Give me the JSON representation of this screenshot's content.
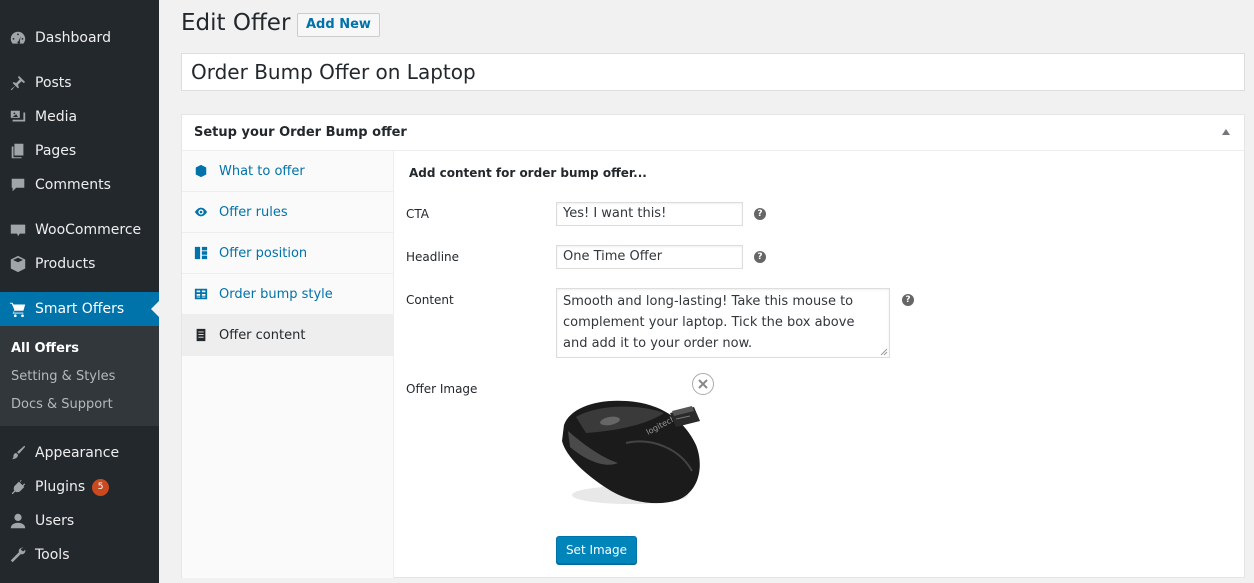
{
  "sidebar": {
    "items": [
      {
        "label": "Dashboard",
        "icon": "dashboard-icon"
      },
      {
        "label": "Posts",
        "icon": "pin-icon"
      },
      {
        "label": "Media",
        "icon": "media-icon"
      },
      {
        "label": "Pages",
        "icon": "pages-icon"
      },
      {
        "label": "Comments",
        "icon": "comment-icon"
      },
      {
        "label": "WooCommerce",
        "icon": "woocommerce-icon"
      },
      {
        "label": "Products",
        "icon": "box-icon"
      },
      {
        "label": "Smart Offers",
        "icon": "cart-icon"
      },
      {
        "label": "Appearance",
        "icon": "brush-icon"
      },
      {
        "label": "Plugins",
        "icon": "plugin-icon",
        "badge": "5"
      },
      {
        "label": "Users",
        "icon": "user-icon"
      },
      {
        "label": "Tools",
        "icon": "wrench-icon"
      }
    ],
    "submenu": [
      "All Offers",
      "Setting & Styles",
      "Docs & Support"
    ]
  },
  "header": {
    "title": "Edit Offer",
    "add_new": "Add New"
  },
  "post_title": "Order Bump Offer on Laptop",
  "metabox": {
    "title": "Setup your Order Bump offer",
    "tabs": [
      {
        "label": "What to offer",
        "icon": "cube-icon"
      },
      {
        "label": "Offer rules",
        "icon": "eye-icon"
      },
      {
        "label": "Offer position",
        "icon": "layout-icon"
      },
      {
        "label": "Order bump style",
        "icon": "table-icon"
      },
      {
        "label": "Offer content",
        "icon": "document-icon"
      }
    ],
    "content": {
      "heading": "Add content for order bump offer...",
      "cta_label": "CTA",
      "cta_value": "Yes! I want this!",
      "headline_label": "Headline",
      "headline_value": "One Time Offer",
      "content_label": "Content",
      "content_value": "Smooth and long-lasting! Take this mouse to complement your laptop. Tick the box above and add it to your order now.",
      "image_label": "Offer Image",
      "image_brand_text": "logitech",
      "set_image": "Set Image",
      "help": "?"
    }
  },
  "colors": {
    "sidebar_bg": "#23282d",
    "active_menu": "#0073aa",
    "button_primary": "#0085ba",
    "badge": "#ca4a1f"
  }
}
